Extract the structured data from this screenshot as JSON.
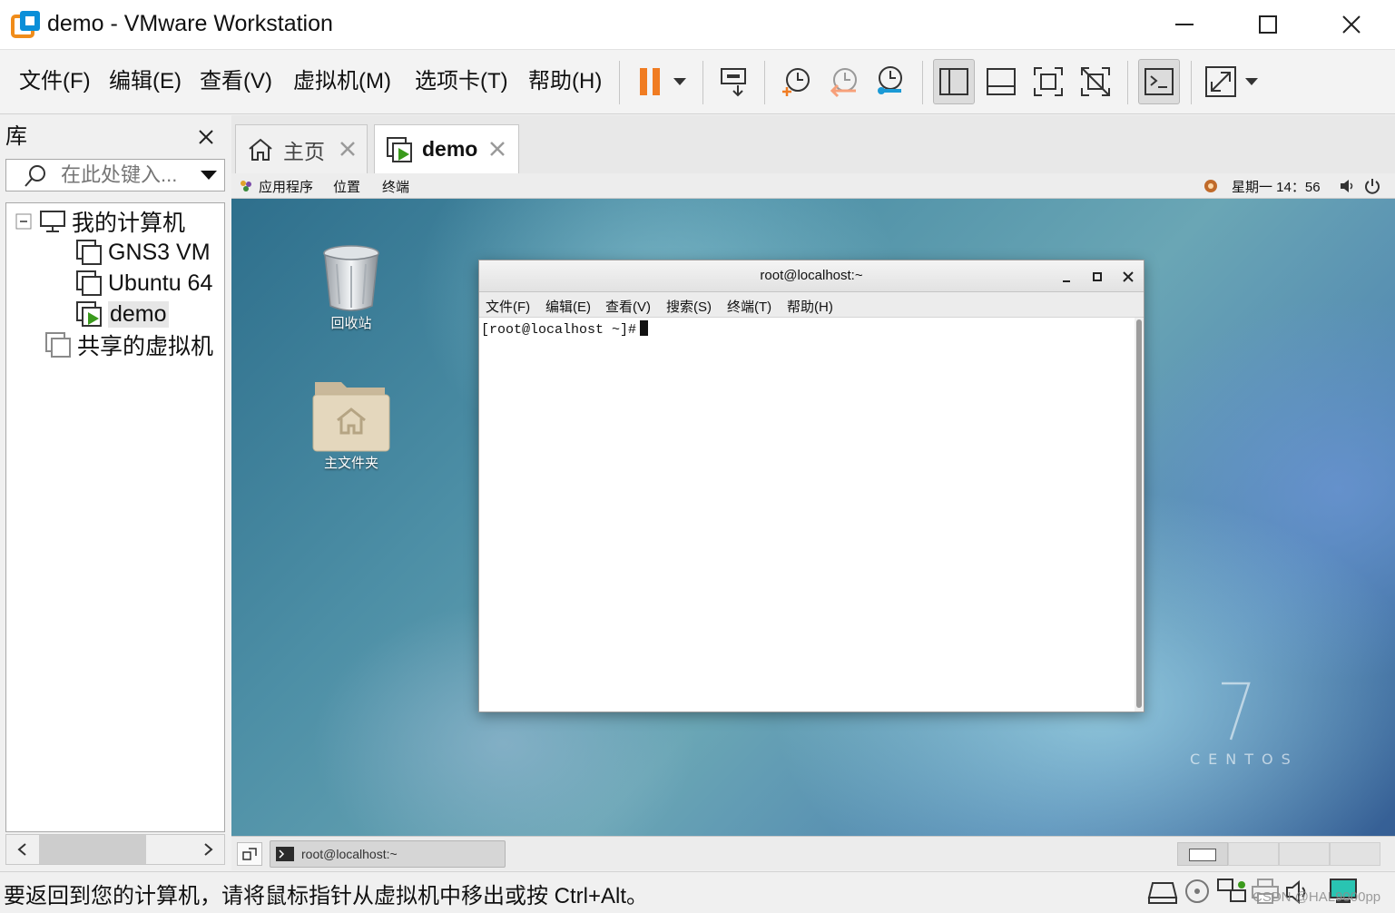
{
  "window": {
    "title": "demo - VMware Workstation",
    "app_icon": "vmware-icon"
  },
  "menubar": {
    "items": [
      "文件(F)",
      "编辑(E)",
      "查看(V)",
      "虚拟机(M)",
      "选项卡(T)",
      "帮助(H)"
    ]
  },
  "toolbar": {
    "buttons": [
      "pause-icon",
      "dropdown-arrow-icon",
      "send-ctrl-alt-del-icon",
      "snapshot-take-icon",
      "snapshot-revert-icon",
      "snapshot-manager-icon",
      "show-library-icon",
      "thumbnail-bar-icon",
      "full-screen-icon",
      "unity-icon",
      "console-view-icon",
      "stretch-view-icon",
      "dropdown-arrow-icon"
    ],
    "accent_pause": "#f07c22"
  },
  "library": {
    "title": "库",
    "search_placeholder": "在此处键入...",
    "tree": {
      "root": "我的计算机",
      "vms": [
        "GNS3 VM",
        "Ubuntu 64",
        "demo"
      ],
      "shared": "共享的虚拟机"
    }
  },
  "tabs": [
    {
      "label": "主页",
      "icon": "home-icon",
      "active": false
    },
    {
      "label": "demo",
      "icon": "vm-running-icon",
      "active": true
    }
  ],
  "guest": {
    "topbar": {
      "applications": "应用程序",
      "places": "位置",
      "terminal": "终端",
      "clock": "星期一 14：56"
    },
    "desktop_icons": [
      "回收站",
      "主文件夹"
    ],
    "brand": {
      "version": "7",
      "name": "CENTOS"
    },
    "terminal_window": {
      "title": "root@localhost:~",
      "menu": [
        "文件(F)",
        "编辑(E)",
        "查看(V)",
        "搜索(S)",
        "终端(T)",
        "帮助(H)"
      ],
      "prompt": "[root@localhost ~]#"
    },
    "taskbar": {
      "task_label": "root@localhost:~"
    }
  },
  "statusbar": {
    "message": "要返回到您的计算机，请将鼠标指针从虚拟机中移出或按 Ctrl+Alt。",
    "watermark": "CSDN @HAL9000pp"
  }
}
